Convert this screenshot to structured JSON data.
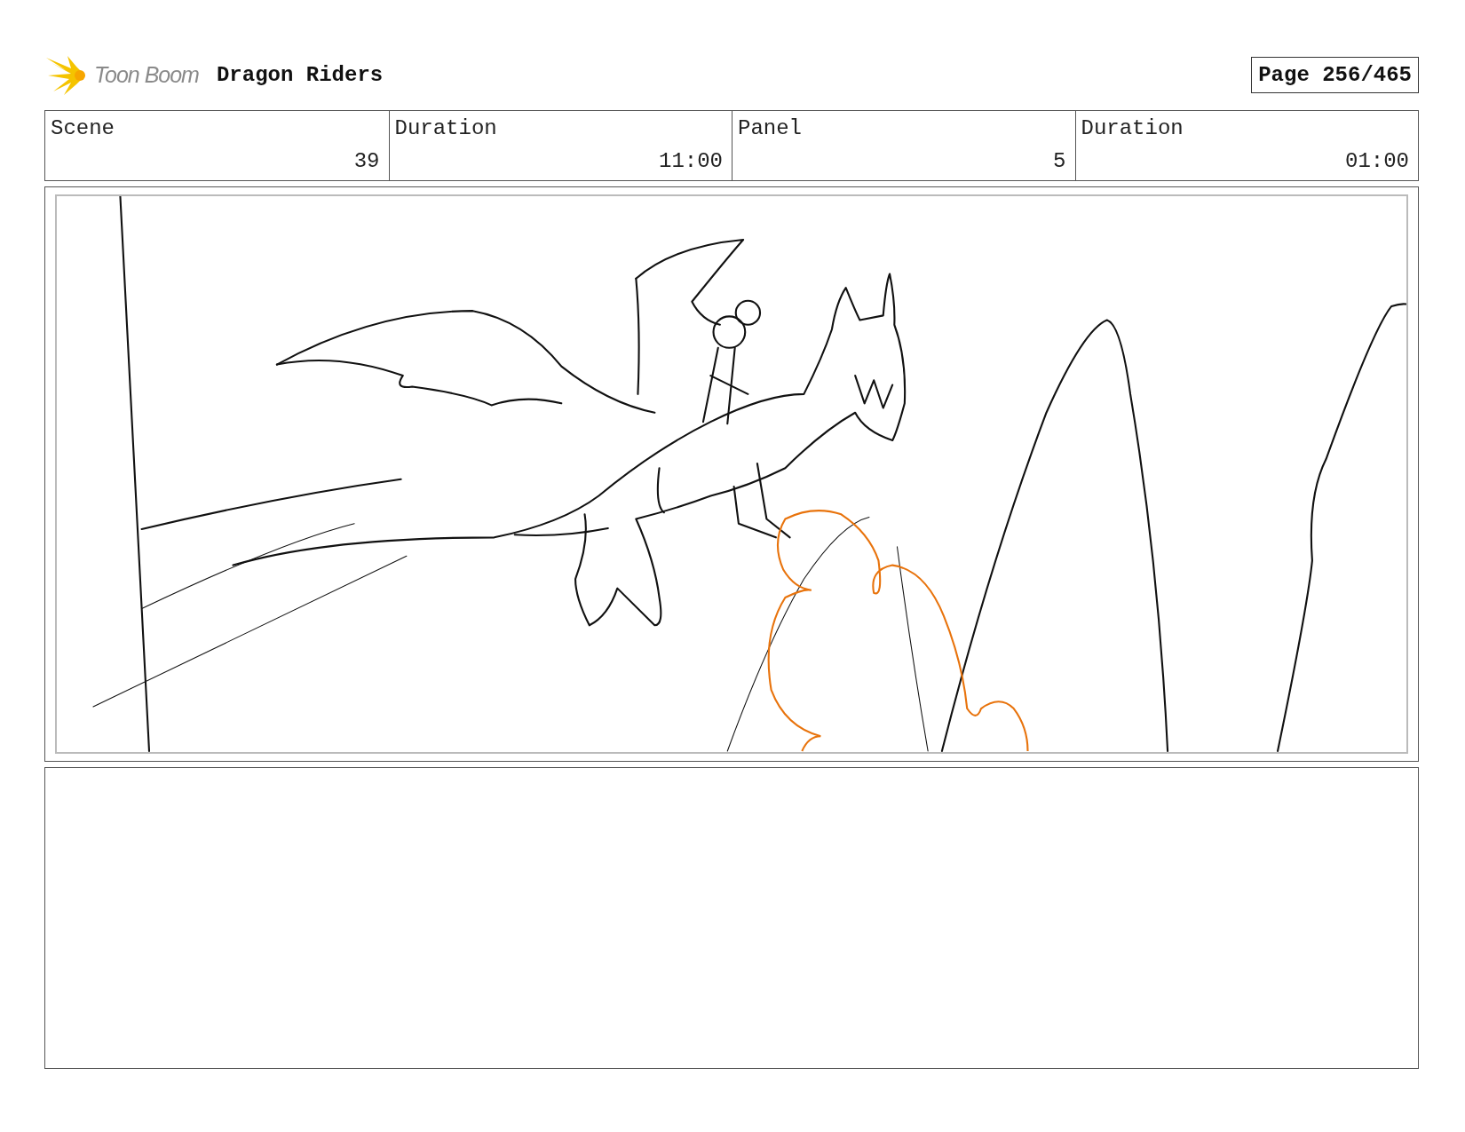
{
  "header": {
    "logo_text": "Toon Boom",
    "title": "Dragon Riders",
    "page": "Page 256/465"
  },
  "info": {
    "labels": [
      "Scene",
      "Duration",
      "Panel",
      "Duration"
    ],
    "values": [
      "39",
      "11:00",
      "5",
      "01:00"
    ]
  }
}
